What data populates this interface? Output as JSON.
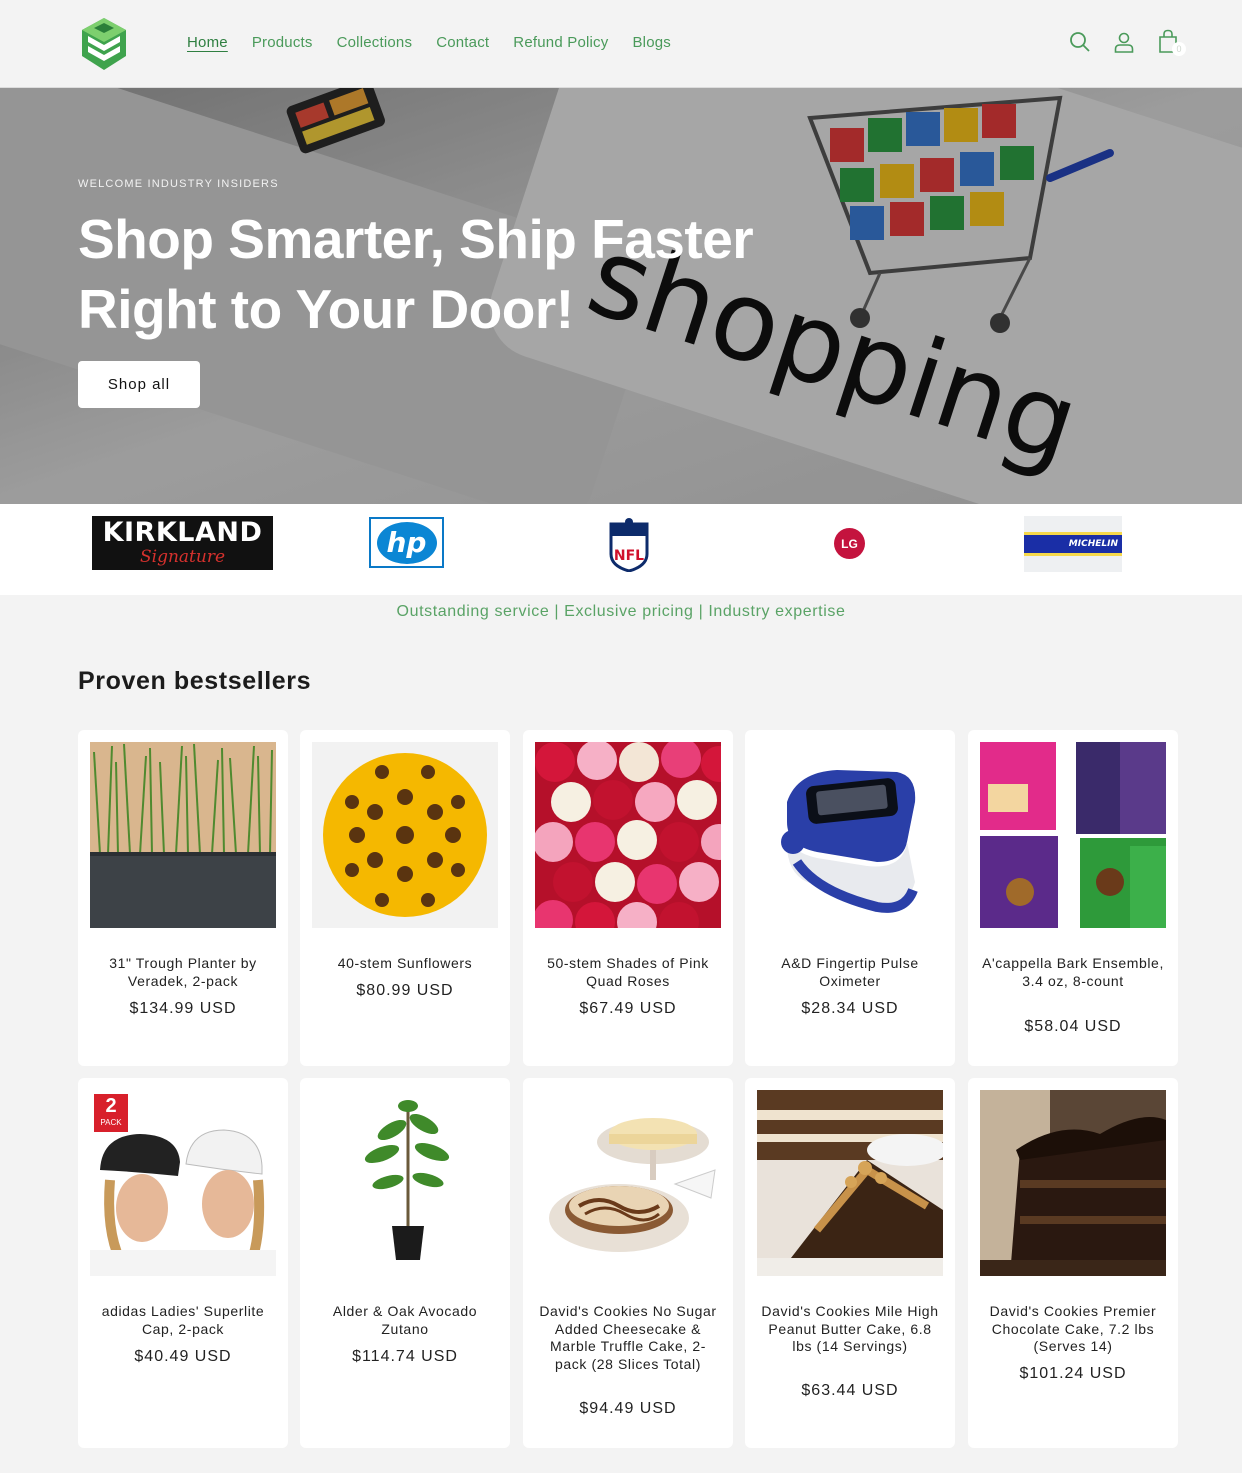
{
  "header": {
    "nav": [
      {
        "label": "Home",
        "active": true
      },
      {
        "label": "Products"
      },
      {
        "label": "Collections"
      },
      {
        "label": "Contact"
      },
      {
        "label": "Refund Policy"
      },
      {
        "label": "Blogs"
      }
    ],
    "cart_count": "0",
    "icons": [
      "search-icon",
      "account-icon",
      "cart-icon"
    ]
  },
  "hero": {
    "eyebrow": "WELCOME INDUSTRY INSIDERS",
    "title_line1": "Shop Smarter, Ship Faster",
    "title_line2": "Right to Your Door!",
    "button": "Shop all",
    "background_text": "shopping"
  },
  "brands": [
    {
      "name": "KIRKLAND",
      "sub": "Signature"
    },
    {
      "name": "hp"
    },
    {
      "name": "NFL"
    },
    {
      "name": "LG"
    },
    {
      "name": "MICHELIN"
    }
  ],
  "tagline": "Outstanding service | Exclusive pricing | Industry expertise",
  "section": {
    "title": "Proven bestsellers"
  },
  "products": [
    {
      "title": "31\" Trough Planter by Veradek, 2-pack",
      "price": "$134.99 USD"
    },
    {
      "title": "40-stem Sunflowers",
      "price": "$80.99 USD"
    },
    {
      "title": "50-stem Shades of Pink Quad Roses",
      "price": "$67.49 USD"
    },
    {
      "title": "A&D Fingertip Pulse Oximeter",
      "price": "$28.34 USD"
    },
    {
      "title": "A'cappella Bark Ensemble, 3.4 oz, 8-count",
      "price": "$58.04 USD"
    },
    {
      "title": "adidas Ladies' Superlite Cap, 2-pack",
      "price": "$40.49 USD",
      "badge": "2",
      "badge_sub": "PACK"
    },
    {
      "title": "Alder & Oak Avocado Zutano",
      "price": "$114.74 USD"
    },
    {
      "title": "David's Cookies No Sugar Added Cheesecake & Marble Truffle Cake, 2-pack (28 Slices Total)",
      "price": "$94.49 USD"
    },
    {
      "title": "David's Cookies Mile High Peanut Butter Cake, 6.8 lbs (14 Servings)",
      "price": "$63.44 USD"
    },
    {
      "title": "David's Cookies Premier Chocolate Cake, 7.2 lbs (Serves 14)",
      "price": "$101.24 USD"
    }
  ],
  "colors": {
    "accent": "#4a9a5a",
    "logo_green": "#3fa34d"
  }
}
